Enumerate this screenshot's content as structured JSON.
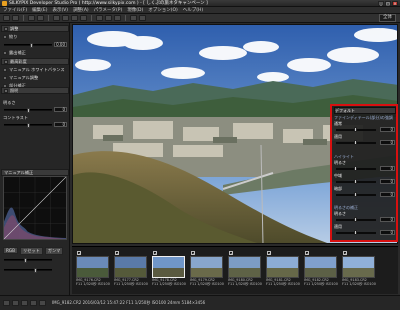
{
  "app": {
    "title": "SILKYPIX Developer Studio Pro ( http://www.silkypix.com ) - [ しくぷの旅ネタキャンペーン ]",
    "window_buttons": [
      "_",
      "□",
      "×"
    ]
  },
  "menu": [
    "ファイル(F)",
    "編集(E)",
    "表示(V)",
    "調整(A)",
    "パラメータ(P)",
    "現像(D)",
    "オプション(O)",
    "ヘルプ(H)"
  ],
  "toolbar": {
    "zoom": "全体"
  },
  "left_panel": {
    "rows": [
      {
        "label": "調整",
        "header": true
      },
      {
        "label": "絞り"
      },
      {
        "label": "露出補正"
      },
      {
        "label": "最高彩度"
      },
      {
        "label": "マニュアル ホワイトバランス"
      },
      {
        "label": "マニュアル調整"
      },
      {
        "label": "部分補正"
      },
      {
        "label": "照明"
      }
    ],
    "sliders": [
      {
        "label": "露出補正値",
        "value": "0.00",
        "pos": 0.55
      },
      {
        "label": "明るさ",
        "value": "0",
        "pos": 0.5
      },
      {
        "label": "コントラスト",
        "value": "0",
        "pos": 0.5
      }
    ],
    "curve_title": "マニュアル補正",
    "bottom_buttons": [
      "RGB",
      "リセット",
      "ガンマ"
    ]
  },
  "right_panel": {
    "title": "デフォルト",
    "sections": [
      {
        "header": "ファインディテール(部分)の強調",
        "items": [
          {
            "label": "通常",
            "value": "0"
          },
          {
            "label": "適用",
            "value": "0"
          }
        ]
      },
      {
        "header": "ハイライト",
        "items": [
          {
            "label": "明るさ",
            "value": "0"
          },
          {
            "label": "中域",
            "value": "0"
          },
          {
            "label": "暗部",
            "value": "0"
          }
        ]
      },
      {
        "header": "明るさの補正",
        "items": [
          {
            "label": "明るさ",
            "value": "0"
          },
          {
            "label": "適用",
            "value": "0"
          }
        ]
      }
    ]
  },
  "filmstrip": {
    "thumbs": [
      {
        "name": "IMG_9176.CR2",
        "info": "F11 1/320秒 ISO100",
        "sel": false
      },
      {
        "name": "IMG_9177.CR2",
        "info": "F11 1/250秒 ISO100",
        "sel": false
      },
      {
        "name": "IMG_9178.CR2",
        "info": "F11 1/250秒 ISO100",
        "sel": true
      },
      {
        "name": "IMG_9179.CR2",
        "info": "F11 1/320秒 ISO100",
        "sel": false
      },
      {
        "name": "IMG_9180.CR2",
        "info": "F11 1/320秒 ISO100",
        "sel": false
      },
      {
        "name": "IMG_9181.CR2",
        "info": "F11 1/250秒 ISO100",
        "sel": false
      },
      {
        "name": "IMG_9182.CR2",
        "info": "F11 1/250秒 ISO100",
        "sel": false
      },
      {
        "name": "IMG_9183.CR2",
        "info": "F11 1/320秒 ISO100",
        "sel": false
      }
    ]
  },
  "status": {
    "text": "IMG_9182.CR2 2016/03/12 15:47:22  F11 1/250秒 ISO100  24mm  5184×3456"
  }
}
